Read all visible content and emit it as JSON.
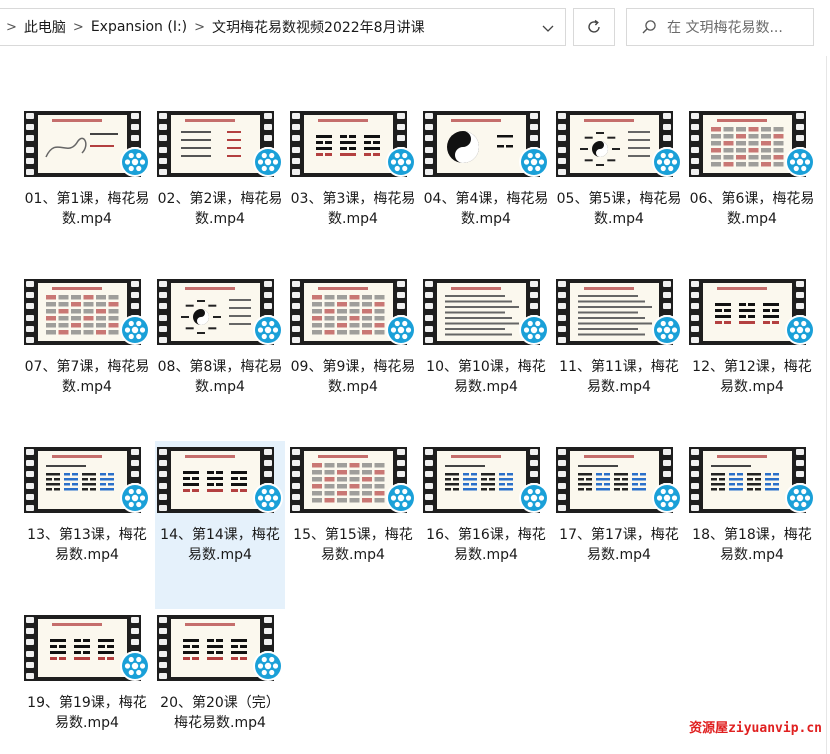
{
  "address_bar": {
    "breadcrumbs": [
      "此电脑",
      "Expansion (I:)",
      "文玥梅花易数视频2022年8月讲课"
    ]
  },
  "search": {
    "placeholder": "在 文玥梅花易数..."
  },
  "files": [
    {
      "label": "01、第1课，梅花易数.mp4",
      "thumb": "dragon"
    },
    {
      "label": "02、第2课，梅花易数.mp4",
      "thumb": "text"
    },
    {
      "label": "03、第3课，梅花易数.mp4",
      "thumb": "trigrams"
    },
    {
      "label": "04、第4课，梅花易数.mp4",
      "thumb": "taiji"
    },
    {
      "label": "05、第5课，梅花易数.mp4",
      "thumb": "bagua"
    },
    {
      "label": "06、第6课，梅花易数.mp4",
      "thumb": "table"
    },
    {
      "label": "07、第7课，梅花易数.mp4",
      "thumb": "table"
    },
    {
      "label": "08、第8课，梅花易数.mp4",
      "thumb": "bagua"
    },
    {
      "label": "09、第9课，梅花易数.mp4",
      "thumb": "table"
    },
    {
      "label": "10、第10课，梅花易数.mp4",
      "thumb": "lines"
    },
    {
      "label": "11、第11课，梅花易数.mp4",
      "thumb": "lines"
    },
    {
      "label": "12、第12课，梅花易数.mp4",
      "thumb": "trigrams"
    },
    {
      "label": "13、第13课，梅花易数.mp4",
      "thumb": "hex"
    },
    {
      "label": "14、第14课，梅花易数.mp4",
      "thumb": "trigrams",
      "selected": true
    },
    {
      "label": "15、第15课，梅花易数.mp4",
      "thumb": "table"
    },
    {
      "label": "16、第16课，梅花易数.mp4",
      "thumb": "hex"
    },
    {
      "label": "17、第17课，梅花易数.mp4",
      "thumb": "hex"
    },
    {
      "label": "18、第18课，梅花易数.mp4",
      "thumb": "hex"
    },
    {
      "label": "19、第19课，梅花易数.mp4",
      "thumb": "trigrams"
    },
    {
      "label": "20、第20课（完）梅花易数.mp4",
      "thumb": "trigrams"
    }
  ],
  "watermark": "资源屋ziyuanvip.cn",
  "colors": {
    "selection": "#e5f1fb",
    "badge": "#1aa0d8",
    "watermark": "#e02020"
  },
  "icons": {
    "refresh": "refresh-icon",
    "search": "search-icon",
    "media": "media-player-icon"
  }
}
